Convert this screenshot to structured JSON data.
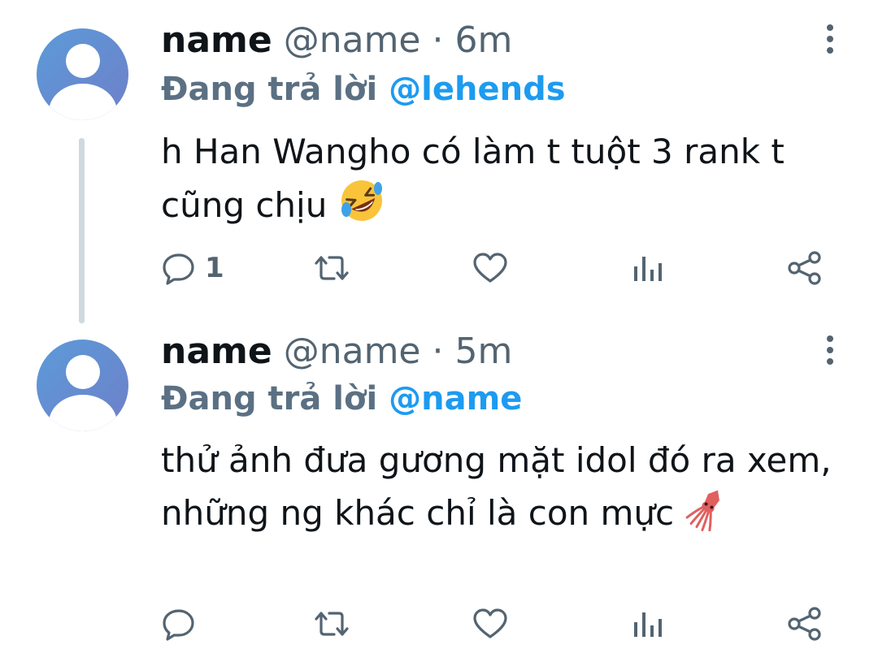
{
  "tweets": [
    {
      "name": "name",
      "handle": "@name",
      "separator": "·",
      "time": "6m",
      "reply_prefix": "Đang trả lời",
      "reply_to": "@lehends",
      "text": "h Han Wangho có làm t tuột 3 rank t cũng chịu",
      "emoji": "rolling-on-floor-laughing-emoji",
      "reply_count": "1"
    },
    {
      "name": "name",
      "handle": "@name",
      "separator": "·",
      "time": "5m",
      "reply_prefix": "Đang trả lời",
      "reply_to": "@name",
      "text": "thử ảnh đưa gương mặt idol đó ra xem, những ng khác chỉ là con mực",
      "emoji": "squid-emoji",
      "reply_count": ""
    }
  ],
  "colors": {
    "secondary_text": "#536471",
    "mention": "#1d9bf0",
    "thread_line": "#cfd9de",
    "icon": "#536471"
  }
}
